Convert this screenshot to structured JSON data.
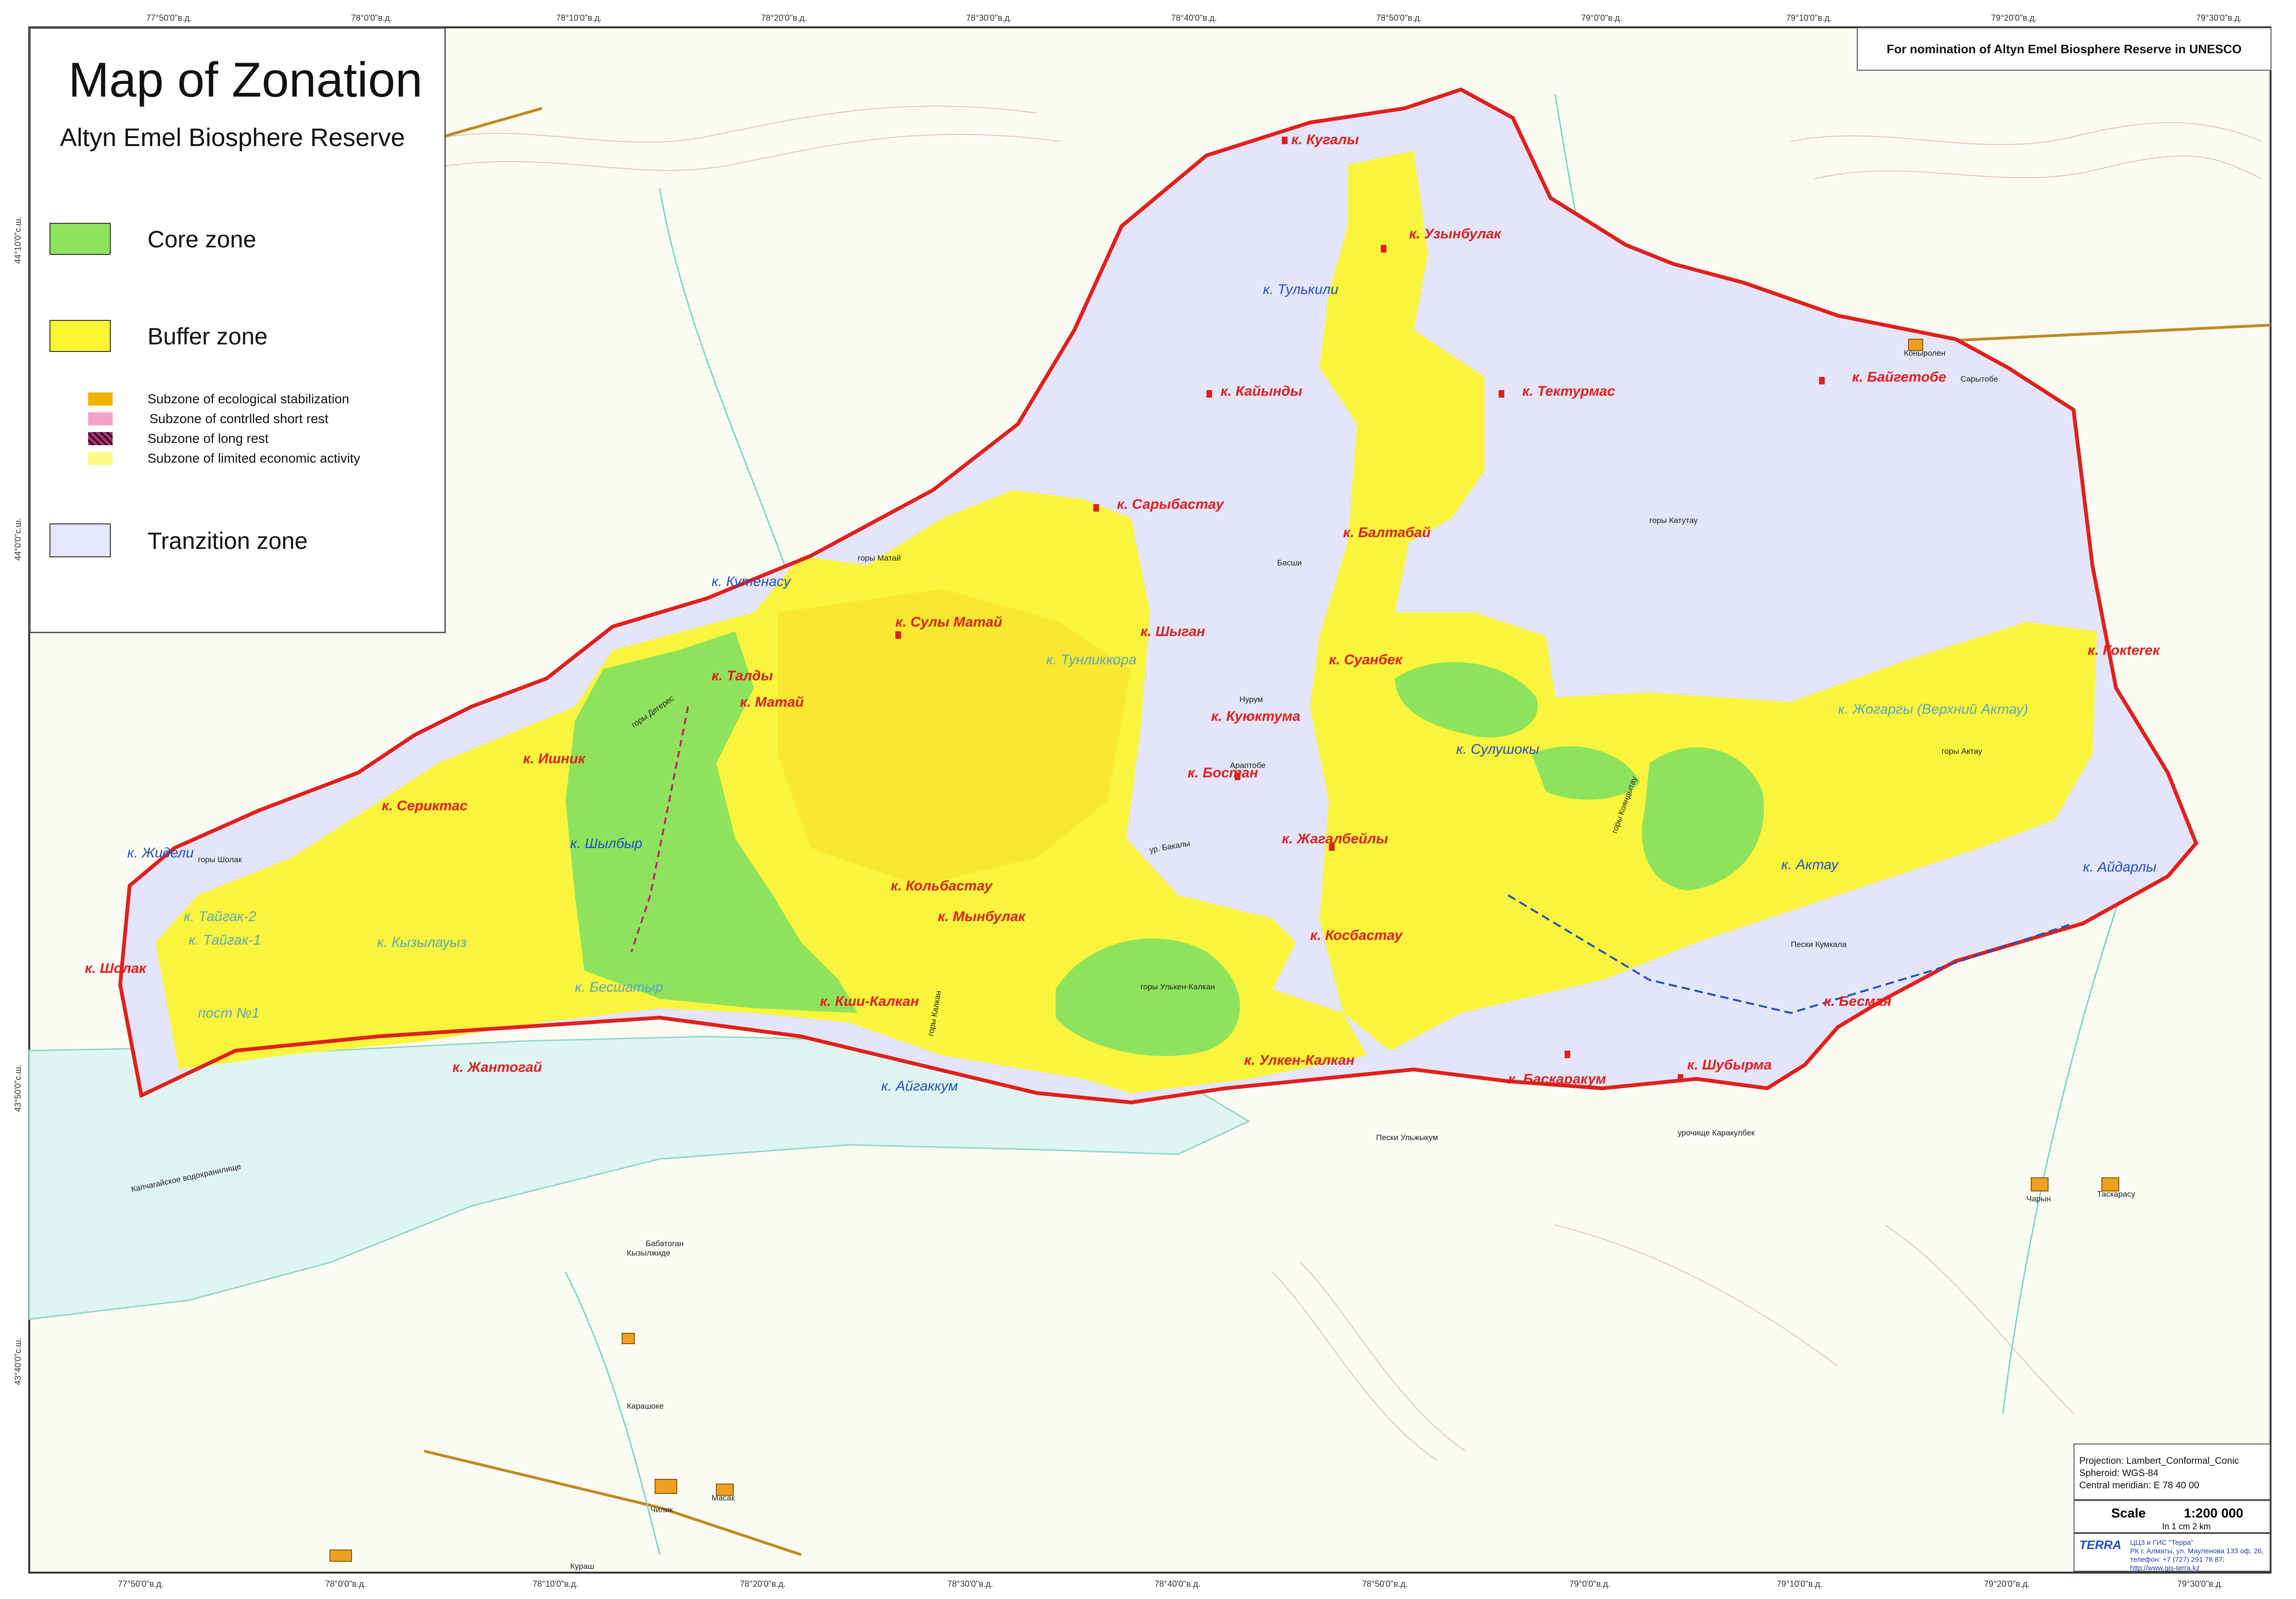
{
  "legend": {
    "title": "Map of Zonation",
    "subtitle": "Altyn Emel Biosphere Reserve",
    "zones": [
      {
        "label": "Core zone",
        "color": "#8ee35c"
      },
      {
        "label": "Buffer zone",
        "color": "#fbf532"
      },
      {
        "label": "Tranzition zone",
        "color": "#e6e6fa"
      }
    ],
    "subzones": [
      {
        "label": "Subzone of ecological stabilization",
        "color": "#f2b300"
      },
      {
        "label": "Subzone of contrlled short rest",
        "color": "#f7a1c8"
      },
      {
        "label": "Subzone of long rest",
        "color": "#b0306e"
      },
      {
        "label": "Subzone of limited economic activity",
        "color": "#fafa86"
      }
    ]
  },
  "nomination": "For nomination of Altyn Emel Biosphere Reserve in UNESCO",
  "projection": {
    "projection": "Projection:  Lambert_Conformal_Conic",
    "spheroid": "Spheroid:  WGS-84",
    "meridian": "Central meridian:  E 78 40 00"
  },
  "scale": {
    "label": "Scale",
    "value": "1:200 000",
    "sub": "In 1 cm 2 km"
  },
  "publisher": {
    "logo": "TERRA",
    "line1": "ЦЦЗ и ГИС \"Терра\"",
    "line2": "РК г. Алматы, ул. Мауленова 133 оф. 26,",
    "line3": "телефон: +7 (727) 291 78 87;",
    "line4": "http://www.gis-terra.kz"
  },
  "coords_top": [
    "77°50'0\"в.д.",
    "78°0'0\"в.д.",
    "78°10'0\"в.д.",
    "78°20'0\"в.д.",
    "78°30'0\"в.д.",
    "78°40'0\"в.д.",
    "78°50'0\"в.д.",
    "79°0'0\"в.д.",
    "79°10'0\"в.д.",
    "79°20'0\"в.д.",
    "79°30'0\"в.д."
  ],
  "coords_bottom": [
    "77°50'0\"в.д.",
    "78°0'0\"в.д.",
    "78°10'0\"в.д.",
    "78°20'0\"в.д.",
    "78°30'0\"в.д.",
    "78°40'0\"в.д.",
    "78°50'0\"в.д.",
    "79°0'0\"в.д.",
    "79°10'0\"в.д.",
    "79°20'0\"в.д.",
    "79°30'0\"в.д."
  ],
  "coords_left": [
    "44°10'0\"с.ш.",
    "44°0'0\"с.ш.",
    "43°50'0\"с.ш.",
    "43°40'0\"с.ш."
  ],
  "places_red": [
    "к. Кугалы",
    "к. Узынбулак",
    "к. Тектурмас",
    "к. Байгетобе",
    "к. Кайынды",
    "к. Сарыбастау",
    "к. Балтабай",
    "к. Сулы Матай",
    "к. Талды",
    "к. Матай",
    "к. Кокterек",
    "к. Суанбек",
    "к. Куюктума",
    "к. Бостан",
    "к. Жагалбейлы",
    "к. Ишник",
    "к. Сериктас",
    "к. Кольбастау",
    "к. Мынбулак",
    "к. Косбастау",
    "к. Кши-Калкан",
    "к. Улкен-Калкан",
    "к. Баскаракум",
    "к. Шубырма",
    "к. Бесмая",
    "к. Жантогай",
    "к. Шолак",
    "к. Шыган"
  ],
  "places_blue": [
    "к. Тулькили",
    "к. Кутенасу",
    "к. Шылбыр",
    "к. Жидели",
    "к. Айгаккум",
    "к. Айдарлы",
    "к. Актау",
    "к. Сулушокы"
  ],
  "places_teal": [
    "к. Тайгак-2",
    "к. Тайгак-1",
    "к. Кызылауыз",
    "пост №1",
    "к. Бесшатыр",
    "к. Тунликкора",
    "к. Жогаргы (Верхний Актау)"
  ],
  "places_black": [
    "горы Шолак",
    "горы Матай",
    "горы Дегерес",
    "горы Катутау",
    "горы Актау",
    "горы Улькен-Калкан",
    "горы Кояндытау",
    "горы Калкан",
    "Пески Кумкала",
    "урочище Каракулбек",
    "Пески Ульжыкум",
    "Капчагайское водохранилище",
    "Чилик",
    "Масак",
    "Карашоке",
    "Чарын",
    "Таскарасу",
    "Бабатоган",
    "Кызылжиде",
    "Кураш",
    "Коныролен",
    "Басши",
    "Нурум",
    "Араптобе",
    "ур. Бакалы",
    "Сарытобе"
  ]
}
